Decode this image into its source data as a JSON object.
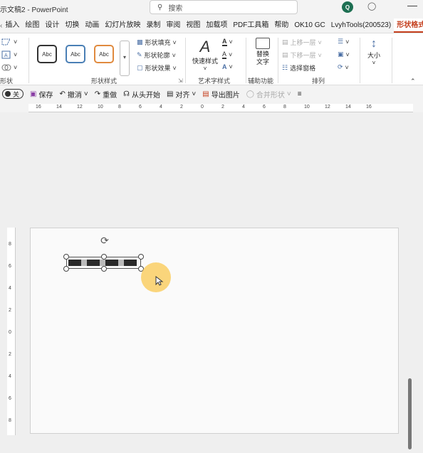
{
  "titlebar": {
    "doc_title": "示文稿2 - PowerPoint",
    "search_placeholder": "搜索",
    "avatar_initial": "Q"
  },
  "tabs": [
    {
      "label": "插入"
    },
    {
      "label": "绘图"
    },
    {
      "label": "设计"
    },
    {
      "label": "切换"
    },
    {
      "label": "动画"
    },
    {
      "label": "幻灯片放映"
    },
    {
      "label": "录制"
    },
    {
      "label": "审阅"
    },
    {
      "label": "视图"
    },
    {
      "label": "加载项"
    },
    {
      "label": "PDF工具箱"
    },
    {
      "label": "帮助"
    },
    {
      "label": "OK10 GC"
    },
    {
      "label": "LvyhTools(200523)"
    },
    {
      "label": "形状格式",
      "active": true
    }
  ],
  "ribbon": {
    "insert_shapes_label": "形状",
    "shape_styles": {
      "label": "形状样式",
      "presets": [
        "Abc",
        "Abc",
        "Abc"
      ],
      "fill": "形状填充",
      "outline": "形状轮廓",
      "effects": "形状效果"
    },
    "wordart": {
      "label": "艺术字样式",
      "quick_styles": "快速样式"
    },
    "accessibility": {
      "label": "辅助功能",
      "alt_text": "替换文字"
    },
    "arrange": {
      "label": "排列",
      "bring_forward": "上移一层",
      "send_backward": "下移一层",
      "selection_pane": "选择窗格"
    },
    "size_label": "大小"
  },
  "qat": {
    "autosave_label": "关",
    "save": "保存",
    "undo": "撤消",
    "redo": "重做",
    "from_start": "从头开始",
    "align": "对齐",
    "export_image": "导出图片",
    "merge_shapes": "合并形状"
  },
  "hruler_labels": [
    "16",
    "14",
    "12",
    "10",
    "8",
    "6",
    "4",
    "2",
    "0",
    "2",
    "4",
    "6",
    "8",
    "10",
    "12",
    "14",
    "16"
  ],
  "vruler_labels": [
    "8",
    "6",
    "4",
    "2",
    "0",
    "2",
    "4",
    "6",
    "8"
  ],
  "colors": {
    "accent": "#c43e1c",
    "avatar": "#1d6f52",
    "highlight": "#f9c850"
  }
}
